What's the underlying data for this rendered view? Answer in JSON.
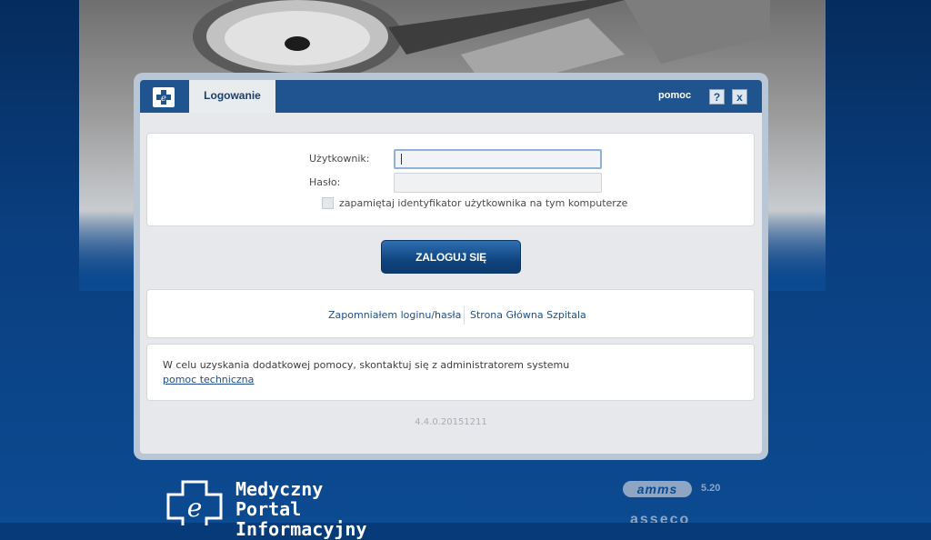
{
  "dialog": {
    "tab_label": "Logowanie",
    "help_label": "pomoc",
    "help_button": "?",
    "close_button": "x"
  },
  "form": {
    "username_label": "Użytkownik:",
    "username_value": "",
    "password_label": "Hasło:",
    "password_value": "",
    "remember_label": "zapamiętaj identyfikator użytkownika na tym komputerze",
    "remember_checked": false
  },
  "login_button": "ZALOGUJ SIĘ",
  "links": {
    "forgot": "Zapomniałem loginu/hasła",
    "home": "Strona Główna Szpitala"
  },
  "help": {
    "text": "W celu uzyskania dodatkowej pomocy, skontaktuj się z administratorem systemu",
    "tech_link": "pomoc techniczna"
  },
  "version": "4.4.0.20151211",
  "footer": {
    "brand_line1": "Medyczny",
    "brand_line2": "Portal",
    "brand_line3": "Informacyjny",
    "amms_logo": "amms",
    "amms_version": "5.20",
    "asseco_logo": "asseco"
  },
  "colors": {
    "accent": "#1f548f",
    "background": "#0c4a91",
    "button": "#10457f"
  }
}
